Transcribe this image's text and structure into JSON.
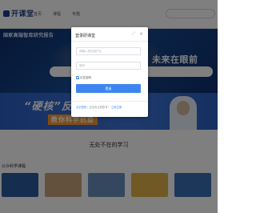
{
  "nav": {
    "logo_text": "开课堂",
    "items": [
      "首页",
      "课程",
      "专题"
    ]
  },
  "banner": {
    "headline_left": "国家高端智库研究报告",
    "subline": "",
    "headline_right": "未来在眼前"
  },
  "promo": {
    "title": "“硬核”反",
    "subtitle": "教你科学抗疫"
  },
  "section": {
    "title": "无处不在的学习",
    "list_label": "公众科学课程"
  },
  "cards": [
    {
      "color": "#2b5a9e",
      "caption": ""
    },
    {
      "color": "#c8a37a",
      "caption": ""
    },
    {
      "color": "#6b8fbf",
      "caption": ""
    },
    {
      "color": "#e2b24a",
      "caption": ""
    },
    {
      "color": "#3a6fb5",
      "caption": ""
    }
  ],
  "modal": {
    "title": "登录研课堂",
    "username_placeholder": "请输入您的用户名",
    "password_placeholder": "密码",
    "remember_label": "记住密码",
    "login_label": "登录",
    "footer_link1": "忘记密码",
    "footer_sep": "|",
    "footer_text": "还没有注册账号？",
    "footer_link2": "立即注册"
  },
  "colors": {
    "accent": "#3d86f2",
    "banner_dark": "#0c2e6b",
    "promo_blue": "#2a5fc4",
    "promo_orange": "#ff9a2e"
  },
  "icons": {
    "close": "close-icon",
    "minimize": "minimize-icon",
    "checkbox": "checkbox-checked-icon"
  }
}
